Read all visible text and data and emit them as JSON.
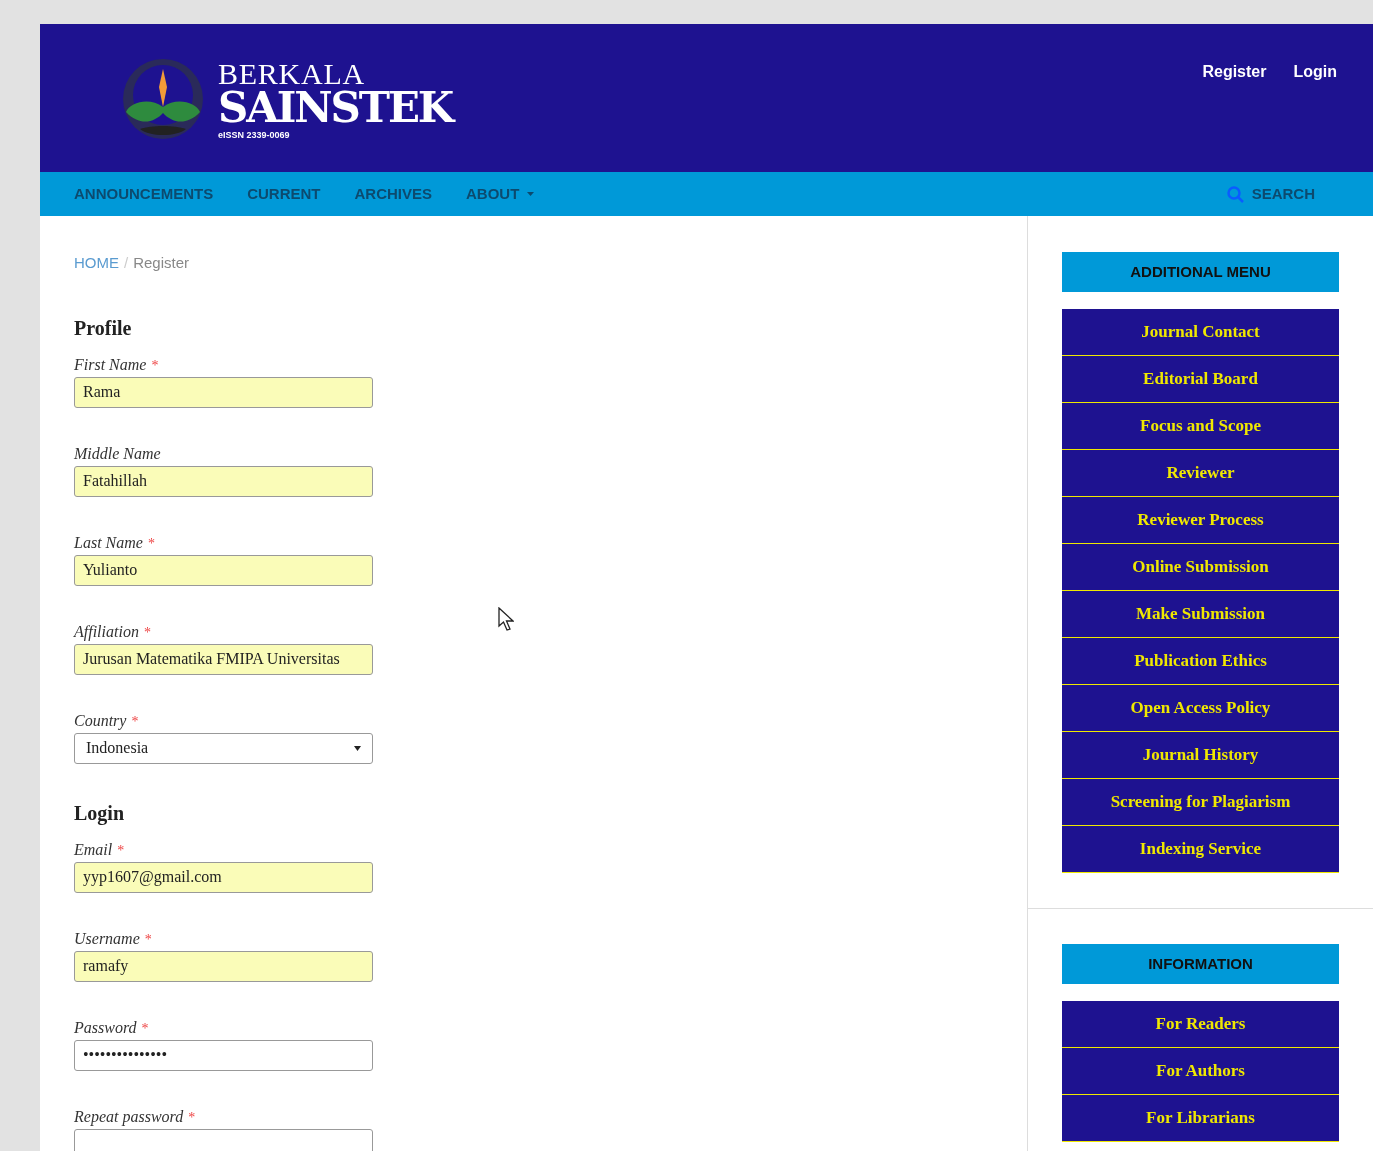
{
  "header": {
    "logo": {
      "line1": "BERKALA",
      "line2": "SAINSTEK",
      "issn": "eISSN 2339-0069"
    },
    "user_links": [
      "Register",
      "Login"
    ]
  },
  "nav": {
    "items": [
      {
        "label": "ANNOUNCEMENTS",
        "has_dropdown": false
      },
      {
        "label": "CURRENT",
        "has_dropdown": false
      },
      {
        "label": "ARCHIVES",
        "has_dropdown": false
      },
      {
        "label": "ABOUT",
        "has_dropdown": true
      }
    ],
    "search": "SEARCH"
  },
  "breadcrumb": {
    "home": "HOME",
    "separator": "/",
    "current": "Register"
  },
  "sections": [
    {
      "title": "Profile",
      "fields": [
        {
          "label": "First Name",
          "required": true,
          "kind": "text",
          "value": "Rama",
          "autofilled": true
        },
        {
          "label": "Middle Name",
          "required": false,
          "kind": "text",
          "value": "Fatahillah",
          "autofilled": true
        },
        {
          "label": "Last Name",
          "required": true,
          "kind": "text",
          "value": "Yulianto",
          "autofilled": true
        },
        {
          "label": "Affiliation",
          "required": true,
          "kind": "text",
          "value": "Jurusan Matematika FMIPA Universitas",
          "autofilled": true
        },
        {
          "label": "Country",
          "required": true,
          "kind": "select",
          "value": "Indonesia",
          "autofilled": false
        }
      ]
    },
    {
      "title": "Login",
      "fields": [
        {
          "label": "Email",
          "required": true,
          "kind": "text",
          "value": "yyp1607@gmail.com",
          "autofilled": true
        },
        {
          "label": "Username",
          "required": true,
          "kind": "text",
          "value": "ramafy",
          "autofilled": true
        },
        {
          "label": "Password",
          "required": true,
          "kind": "password",
          "value": "•••••••••••••••",
          "autofilled": false
        },
        {
          "label": "Repeat password",
          "required": true,
          "kind": "password",
          "autofilled": false
        }
      ]
    }
  ],
  "required_mark": "*",
  "sidebar": [
    {
      "title": "ADDITIONAL MENU",
      "items": [
        "Journal Contact",
        "Editorial Board",
        "Focus and Scope",
        "Reviewer",
        "Reviewer Process",
        "Online Submission",
        "Make Submission",
        "Publication Ethics",
        "Open Access Policy",
        "Journal History",
        "Screening for Plagiarism",
        "Indexing Service"
      ]
    },
    {
      "title": "INFORMATION",
      "items": [
        "For Readers",
        "For Authors",
        "For Librarians"
      ]
    }
  ]
}
